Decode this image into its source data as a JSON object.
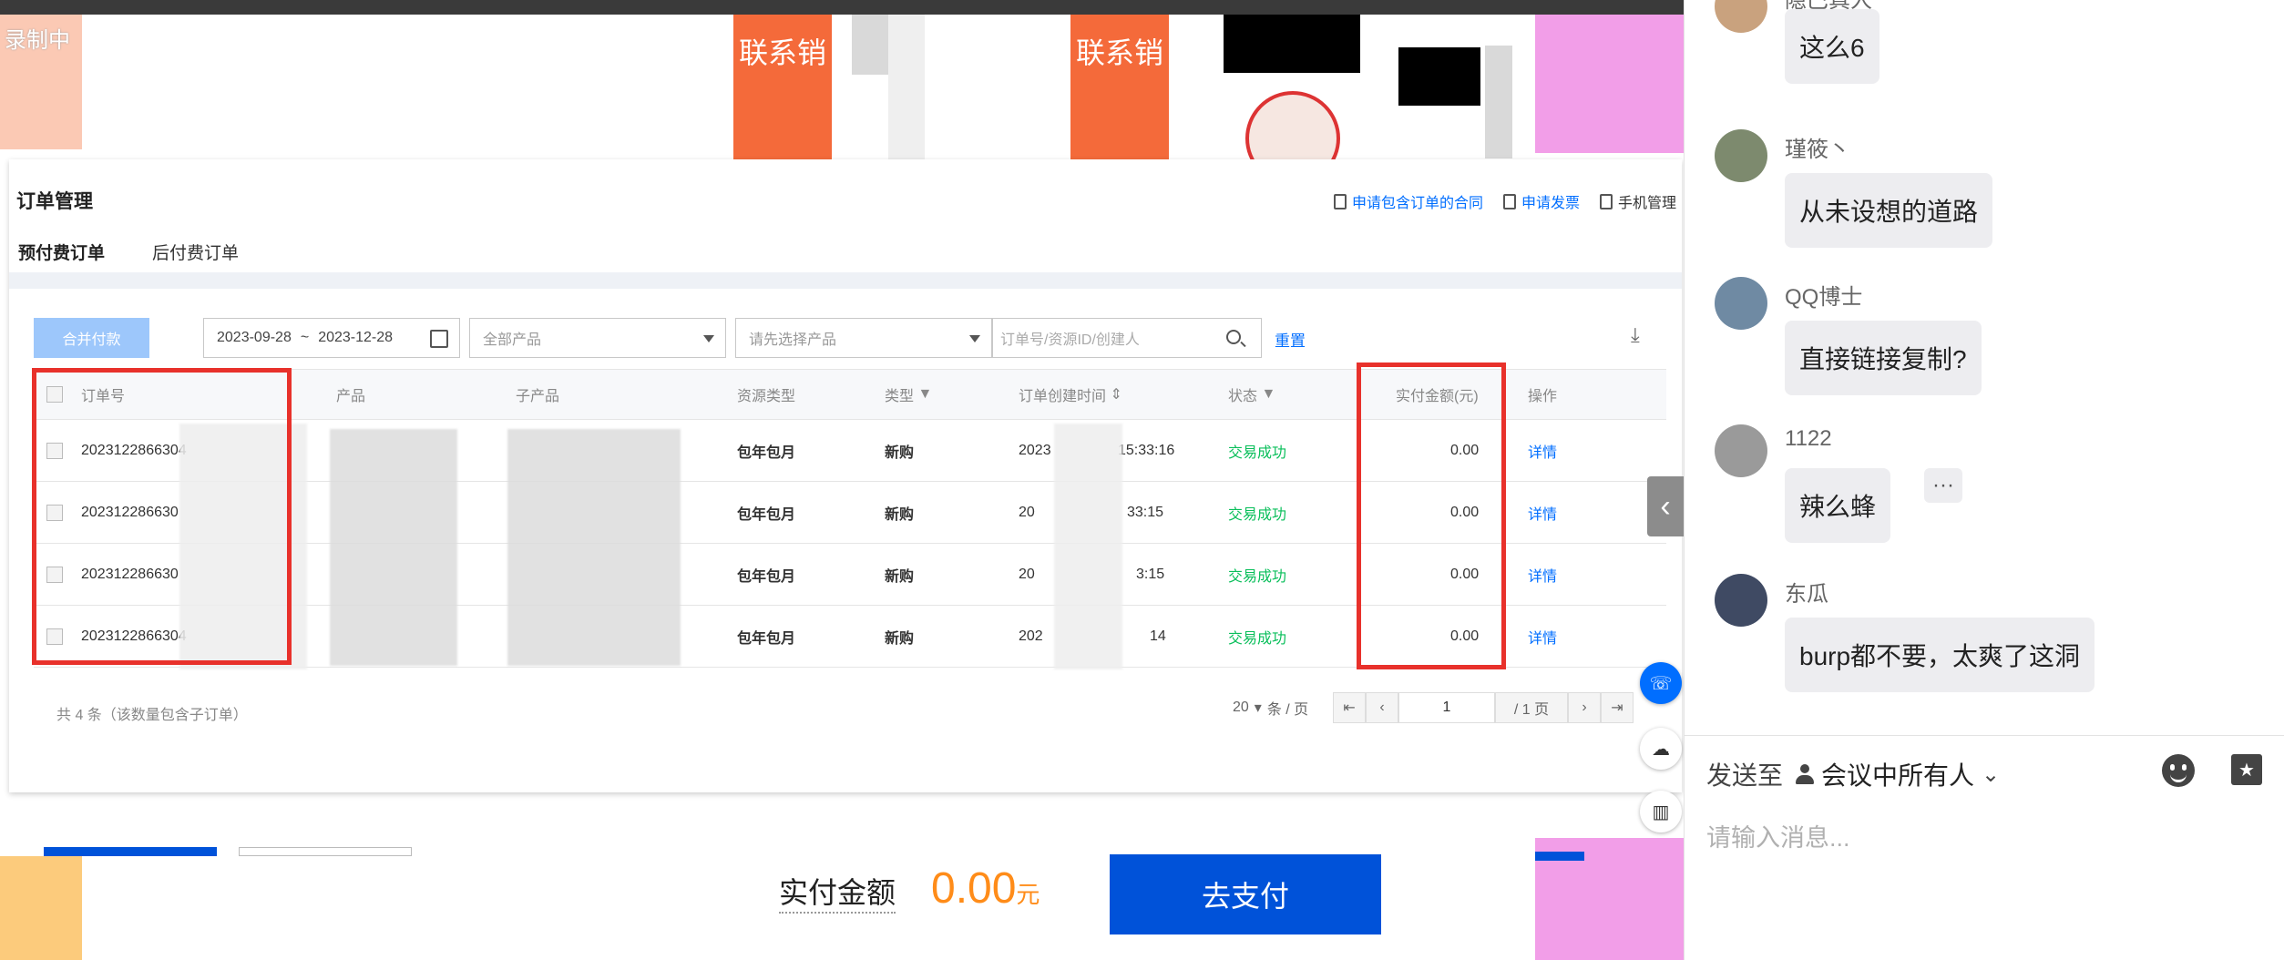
{
  "recording_label": "录制中",
  "background": {
    "banner_text": "联系销"
  },
  "console": {
    "title": "订单管理",
    "header_links": [
      {
        "label": "申请包含订单的合同"
      },
      {
        "label": "申请发票"
      },
      {
        "label": "手机管理"
      }
    ],
    "tabs": [
      {
        "label": "预付费订单",
        "active": true
      },
      {
        "label": "后付费订单",
        "active": false
      }
    ],
    "toolbar": {
      "merge_label": "合并付款",
      "date_start": "2023-09-28",
      "date_sep": "~",
      "date_end": "2023-12-28",
      "product_placeholder": "全部产品",
      "subproduct_placeholder": "请先选择产品",
      "search_placeholder": "订单号/资源ID/创建人",
      "reset_label": "重置"
    },
    "columns": [
      "订单号",
      "产品",
      "子产品",
      "资源类型",
      "类型",
      "订单创建时间",
      "状态",
      "实付金额(元)",
      "操作"
    ],
    "rows": [
      {
        "order_id": "2023122866304",
        "resource_type": "包年包月",
        "type": "新购",
        "time_a": "2023",
        "time_b": "15:33:16",
        "status": "交易成功",
        "amount": "0.00",
        "action": "详情"
      },
      {
        "order_id": "202312286630",
        "resource_type": "包年包月",
        "type": "新购",
        "time_a": "20",
        "time_b": "33:15",
        "status": "交易成功",
        "amount": "0.00",
        "action": "详情"
      },
      {
        "order_id": "202312286630",
        "resource_type": "包年包月",
        "type": "新购",
        "time_a": "20",
        "time_b": "3:15",
        "status": "交易成功",
        "amount": "0.00",
        "action": "详情"
      },
      {
        "order_id": "2023122866304",
        "resource_type": "包年包月",
        "type": "新购",
        "time_a": "202",
        "time_b": "14",
        "status": "交易成功",
        "amount": "0.00",
        "action": "详情"
      }
    ],
    "footer_count": "共 4 条（该数量包含子订单）",
    "pager": {
      "page_size": "20",
      "page_size_unit": "条 / 页",
      "current_page": "1",
      "total_pages": "/ 1 页"
    }
  },
  "payment": {
    "label": "实付金额",
    "amount": "0.00",
    "unit": "元",
    "button_label": "去支付"
  },
  "chat": {
    "messages": [
      {
        "name": "隐巴真人",
        "text": "这么6"
      },
      {
        "name": "瑾筱丶",
        "text": "从未设想的道路"
      },
      {
        "name": "QQ博士",
        "text": "直接链接复制?"
      },
      {
        "name": "1122",
        "text": "辣么蜂"
      },
      {
        "name": "东瓜",
        "text": "burp都不要，太爽了这洞"
      }
    ],
    "more_label": "···",
    "send_to_label": "发送至",
    "send_target": "会议中所有人",
    "input_placeholder": "请输入消息..."
  },
  "colors": {
    "accent_blue": "#006eff",
    "success_green": "#0abf5b",
    "highlight_red": "#e8312b",
    "amount_orange": "#ff8c19",
    "pay_button_blue": "#0052d9"
  }
}
